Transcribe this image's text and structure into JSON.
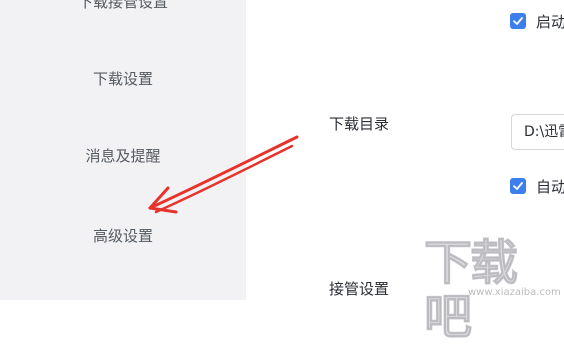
{
  "sidebar": {
    "items": [
      {
        "label": "下载接管设置"
      },
      {
        "label": "下载设置"
      },
      {
        "label": "消息及提醒"
      },
      {
        "label": "高级设置"
      }
    ]
  },
  "main": {
    "start_checkbox": {
      "label": "启动",
      "checked": true
    },
    "download_dir": {
      "label": "下载目录",
      "value": "D:\\迅雷"
    },
    "auto_checkbox": {
      "label": "自动",
      "checked": true
    },
    "takeover": {
      "label": "接管设置"
    }
  },
  "annotation": {
    "color": "#e8332c"
  },
  "watermark": {
    "text": "下载吧",
    "url": "www.xiazaiba.com"
  },
  "colors": {
    "accent": "#3d7eed",
    "sidebar_bg": "#f2f2f4"
  }
}
